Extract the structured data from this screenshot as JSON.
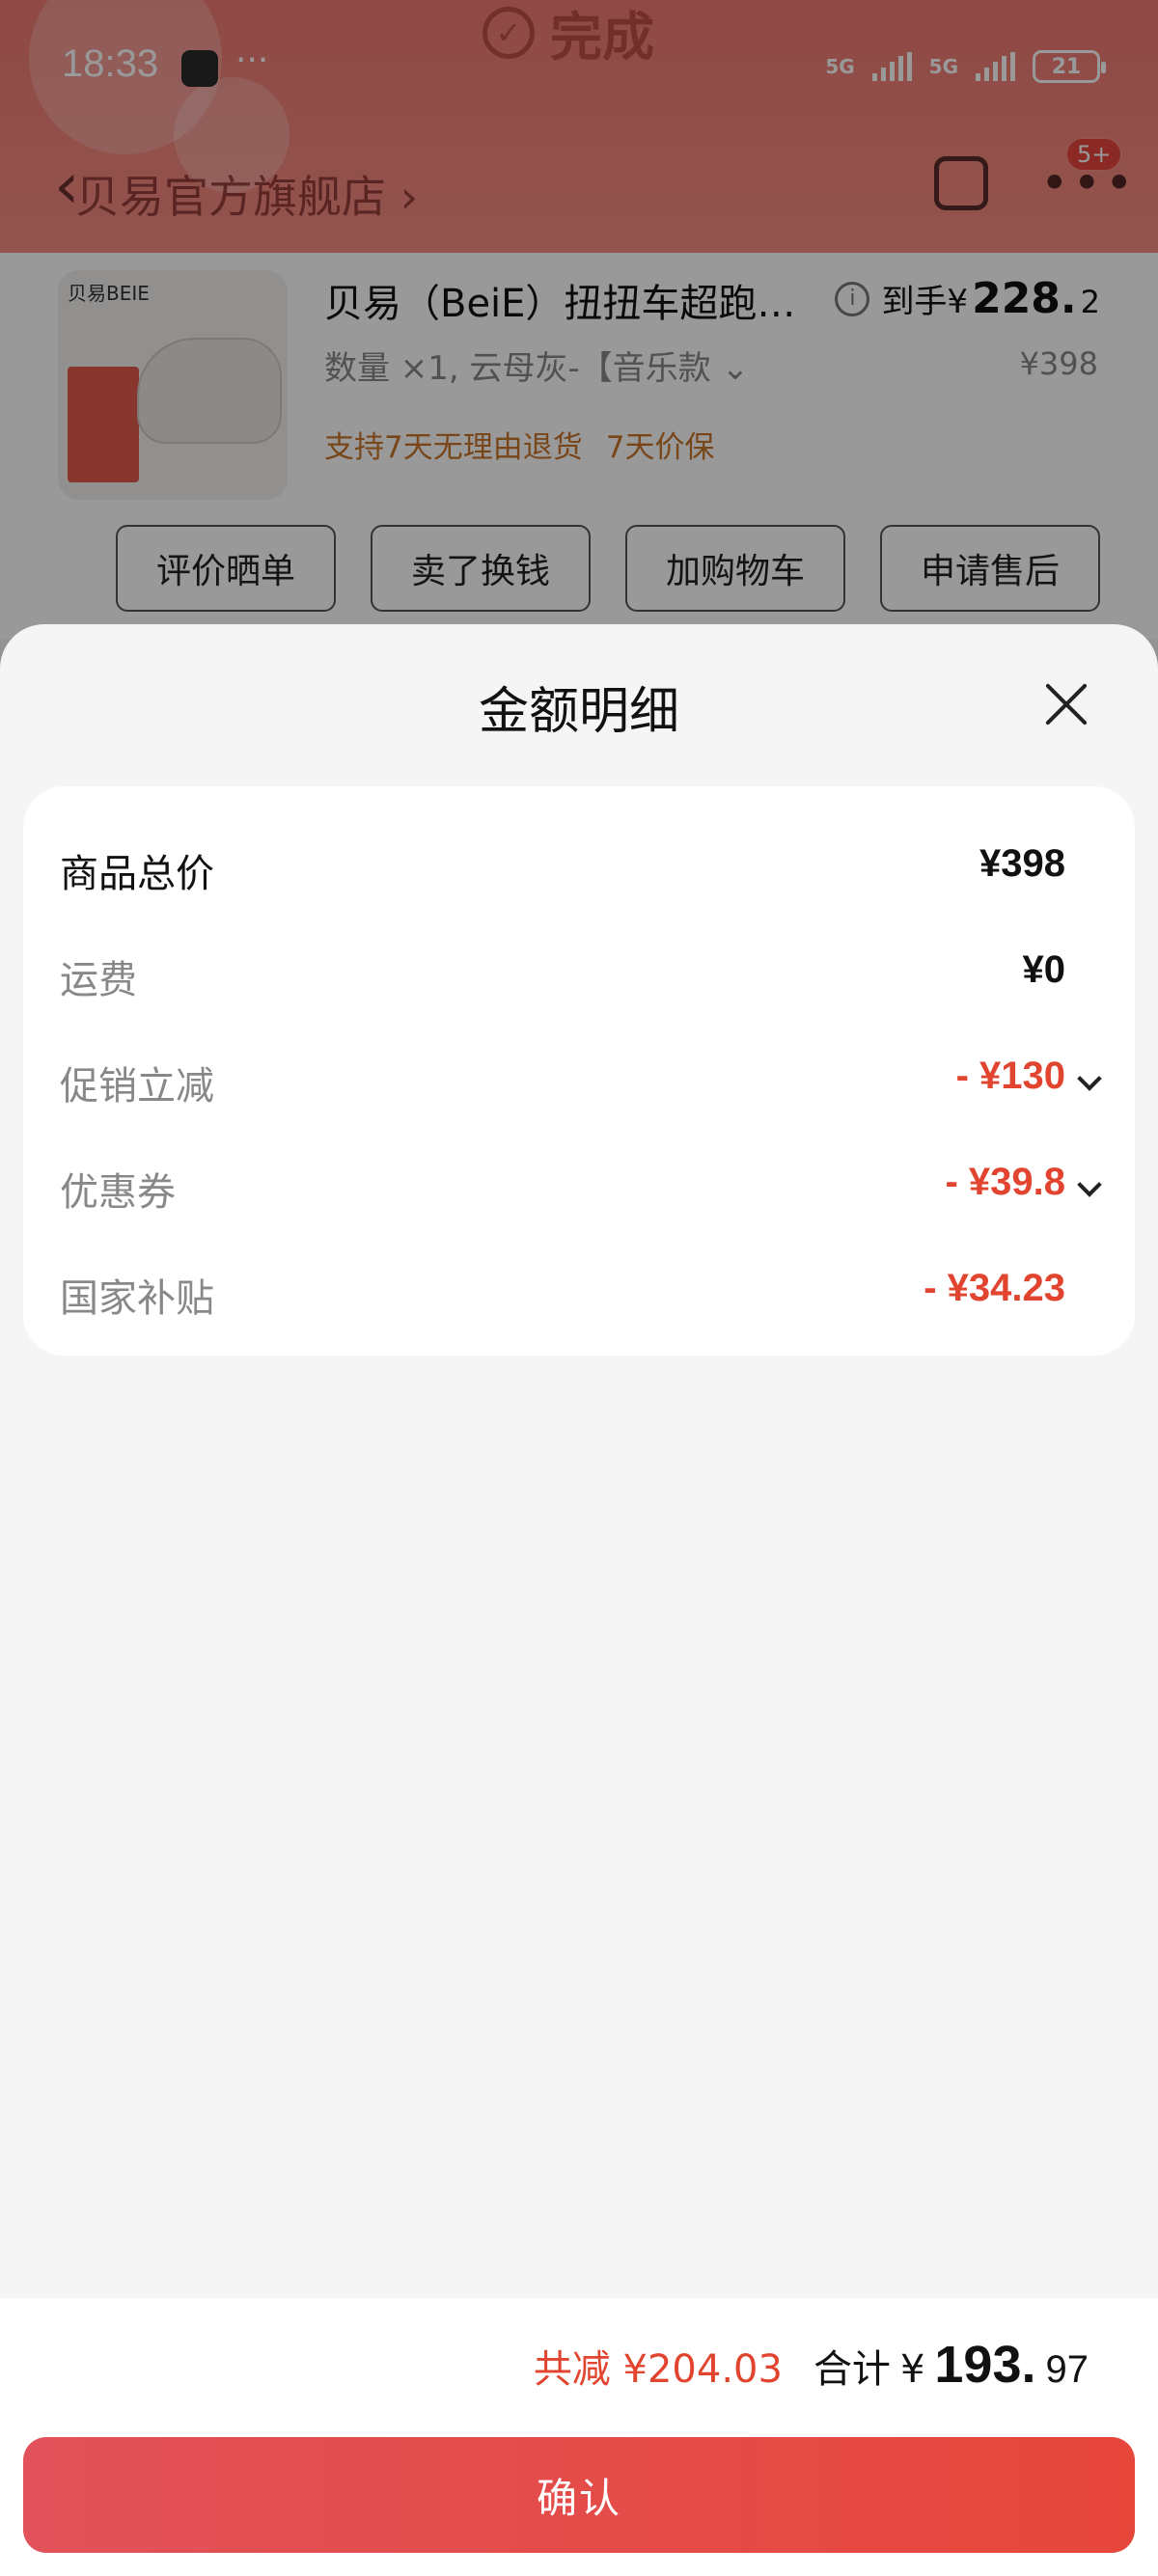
{
  "status_bar": {
    "time": "18:33",
    "dots": "···",
    "net1": "5G",
    "net2": "5G",
    "battery": "21"
  },
  "header": {
    "done_label": "完成",
    "shop_name": "贝易官方旗舰店",
    "notif_badge": "5+"
  },
  "product": {
    "title": "贝易（BeiE）扭扭车超跑…",
    "price_prefix": "到手¥",
    "price_int": "228.",
    "price_dec": "2",
    "spec": "数量 ×1, 云母灰-【音乐款  ⌄",
    "original_price": "¥398",
    "tags": [
      "支持7天无理由退货",
      "7天价保"
    ],
    "thumb_brand": "贝易BEIE"
  },
  "actions": [
    "评价晒单",
    "卖了换钱",
    "加购物车",
    "申请售后"
  ],
  "sheet": {
    "title": "金额明细",
    "rows": [
      {
        "label": "商品总价",
        "value": "¥398"
      },
      {
        "label": "运费",
        "value": "¥0"
      },
      {
        "label": "促销立减",
        "value": "- ¥130"
      },
      {
        "label": "优惠券",
        "value": "- ¥39.8"
      },
      {
        "label": "国家补贴",
        "value": "- ¥34.23"
      }
    ]
  },
  "footer": {
    "saved": "共减 ¥204.03",
    "total_label": "合计",
    "total_currency": "¥",
    "total_int": "193.",
    "total_dec": "97",
    "confirm_label": "确认"
  },
  "colors": {
    "accent": "#e2452f",
    "button": "#e6463a",
    "header": "#f58c82"
  }
}
